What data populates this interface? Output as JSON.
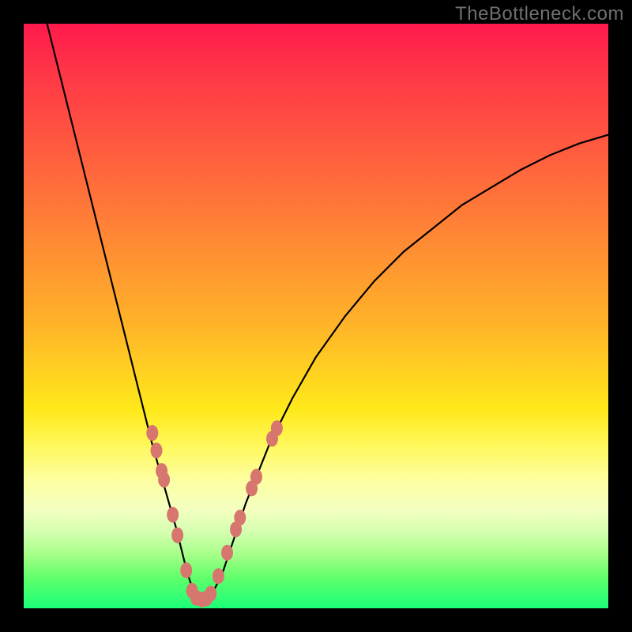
{
  "watermark": "TheBottleneck.com",
  "chart_data": {
    "type": "line",
    "title": "",
    "xlabel": "",
    "ylabel": "",
    "xlim": [
      0,
      100
    ],
    "ylim": [
      0,
      100
    ],
    "grid": false,
    "legend": false,
    "series": [
      {
        "name": "bottleneck-curve",
        "x": [
          4,
          6,
          8,
          10,
          12,
          14,
          16,
          18,
          20,
          22,
          24,
          26,
          27,
          28,
          29,
          30,
          31,
          32,
          34,
          36,
          38,
          42,
          46,
          50,
          55,
          60,
          65,
          70,
          75,
          80,
          85,
          90,
          95,
          100
        ],
        "y": [
          100,
          92,
          84,
          76,
          68,
          60,
          52,
          44,
          36,
          28,
          21,
          14,
          10,
          6,
          3,
          1.5,
          1.5,
          2,
          6,
          12,
          18,
          28,
          36,
          43,
          50,
          56,
          61,
          65,
          69,
          72,
          75,
          77.5,
          79.5,
          81
        ]
      }
    ],
    "markers": {
      "name": "highlight-dots",
      "points": [
        {
          "x": 22.0,
          "y": 30.0
        },
        {
          "x": 22.7,
          "y": 27.0
        },
        {
          "x": 23.6,
          "y": 23.5
        },
        {
          "x": 24.0,
          "y": 22.0
        },
        {
          "x": 25.5,
          "y": 16.0
        },
        {
          "x": 26.3,
          "y": 12.5
        },
        {
          "x": 27.8,
          "y": 6.5
        },
        {
          "x": 28.8,
          "y": 3.0
        },
        {
          "x": 29.5,
          "y": 1.8
        },
        {
          "x": 30.5,
          "y": 1.5
        },
        {
          "x": 31.3,
          "y": 1.7
        },
        {
          "x": 32.0,
          "y": 2.5
        },
        {
          "x": 33.3,
          "y": 5.5
        },
        {
          "x": 34.8,
          "y": 9.5
        },
        {
          "x": 36.3,
          "y": 13.5
        },
        {
          "x": 37.0,
          "y": 15.5
        },
        {
          "x": 39.0,
          "y": 20.5
        },
        {
          "x": 39.8,
          "y": 22.5
        },
        {
          "x": 42.5,
          "y": 29.0
        },
        {
          "x": 43.3,
          "y": 30.8
        }
      ]
    },
    "gradient_stops": [
      {
        "pos": 0,
        "color": "#ff1a4d"
      },
      {
        "pos": 50,
        "color": "#ffb528"
      },
      {
        "pos": 70,
        "color": "#fff85a"
      },
      {
        "pos": 100,
        "color": "#1bff78"
      }
    ]
  }
}
